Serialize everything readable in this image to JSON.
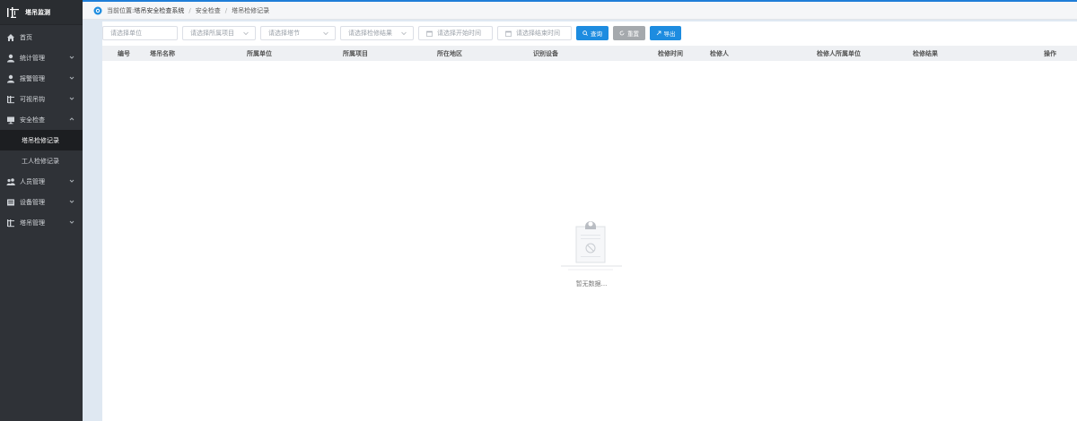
{
  "sidebar": {
    "logo_text": "塔吊监测",
    "items": [
      {
        "label": "首页",
        "icon": "home-icon"
      },
      {
        "label": "统计管理",
        "icon": "user-icon"
      },
      {
        "label": "报警管理",
        "icon": "user-icon"
      },
      {
        "label": "可视吊钩",
        "icon": "building-icon"
      },
      {
        "label": "安全检查",
        "icon": "monitor-icon"
      },
      {
        "label": "塔吊检修记录",
        "sub": true,
        "active": true
      },
      {
        "label": "工人检修记录",
        "sub": true
      },
      {
        "label": "人员管理",
        "icon": "people-icon"
      },
      {
        "label": "设备管理",
        "icon": "device-icon"
      },
      {
        "label": "塔吊管理",
        "icon": "building-icon"
      }
    ]
  },
  "breadcrumb": {
    "prefix": "当前位置:",
    "root": "塔吊安全检查系统",
    "level1": "安全检查",
    "level2": "塔吊检修记录"
  },
  "filters": {
    "unit_placeholder": "请选择单位",
    "project_placeholder": "请选择所属项目",
    "section_placeholder": "请选择塔节",
    "result_placeholder": "请选择检修结果",
    "start_placeholder": "请选择开始时间",
    "end_placeholder": "请选择结束时间",
    "search_label": "查询",
    "reset_label": "重置",
    "export_label": "导出"
  },
  "table": {
    "headers": [
      "编号",
      "塔吊名称",
      "所属单位",
      "所属项目",
      "所在地区",
      "识别设备",
      "检修时间",
      "检修人",
      "检修人所属单位",
      "检修结果",
      "操作"
    ]
  },
  "empty_text": "暂无数据..."
}
